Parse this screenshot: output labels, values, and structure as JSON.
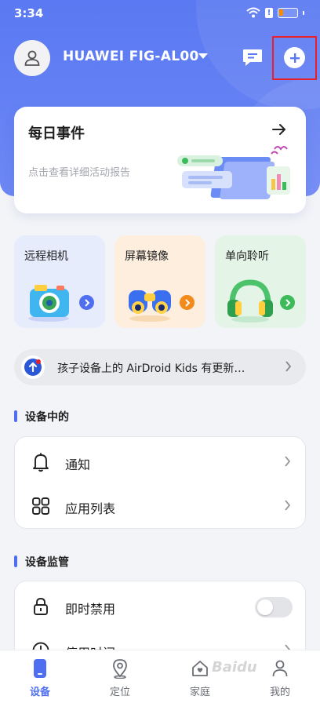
{
  "status_bar": {
    "time": "3:34",
    "battery_percent": 20
  },
  "header": {
    "device_name": "HUAWEI FIG-AL00"
  },
  "daily_card": {
    "title": "每日事件",
    "subtitle": "点击查看详细活动报告"
  },
  "features": [
    {
      "label": "远程相机",
      "bg": "#e7ecfd",
      "accent": "#4f6ff0",
      "icon": "camera-icon"
    },
    {
      "label": "屏幕镜像",
      "bg": "#fdeedd",
      "accent": "#f28a1c",
      "icon": "binoculars-icon"
    },
    {
      "label": "单向聆听",
      "bg": "#e4f5e8",
      "accent": "#3dbb5a",
      "icon": "headphones-icon"
    }
  ],
  "banner": {
    "text": "孩子设备上的 AirDroid Kids 有更新…"
  },
  "section_device": {
    "title": "设备中的",
    "items": [
      {
        "label": "通知",
        "icon": "bell-icon"
      },
      {
        "label": "应用列表",
        "icon": "app-grid-icon"
      }
    ]
  },
  "section_monitor": {
    "title": "设备监管",
    "items": [
      {
        "label": "即时禁用",
        "icon": "lock-icon",
        "toggle_on": false
      },
      {
        "label": "停用时间",
        "icon": "clock-icon"
      }
    ]
  },
  "tabs": [
    {
      "label": "设备",
      "icon": "phone-icon",
      "active": true
    },
    {
      "label": "定位",
      "icon": "location-pin-icon",
      "active": false
    },
    {
      "label": "家庭",
      "icon": "home-icon",
      "active": false
    },
    {
      "label": "我的",
      "icon": "profile-icon",
      "active": false
    }
  ],
  "watermark": {
    "text": "Baidu"
  },
  "colors": {
    "primary": "#4f6ff0",
    "hero": "#5a79f2",
    "highlight": "#e8202a"
  }
}
